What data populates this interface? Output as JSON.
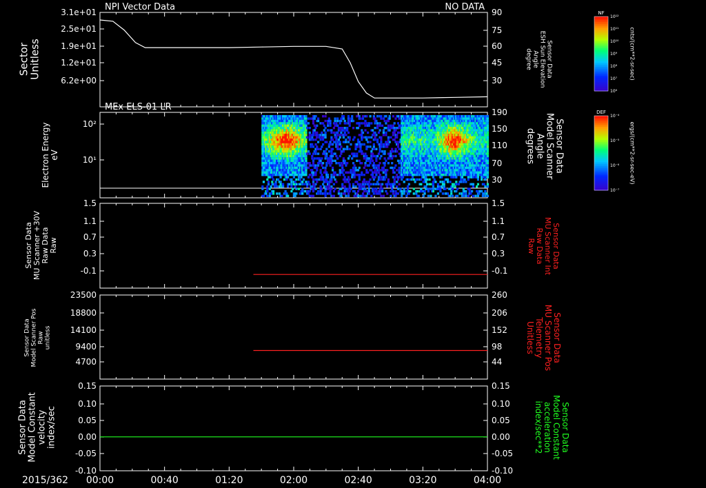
{
  "date_label": "2015/362",
  "time_ticks": [
    "00:00",
    "00:40",
    "01:20",
    "02:00",
    "02:40",
    "03:20",
    "04:00"
  ],
  "panels": [
    {
      "id": "npi",
      "title": "NPI Vector Data",
      "status": "NO DATA",
      "left_label": [
        "Sector",
        "Unitless"
      ],
      "right_label": [
        "Sensor Data",
        "ESH Sun Elevation",
        "Angle",
        "degree"
      ],
      "left_ticks": [
        "3.1e+01",
        "2.5e+01",
        "1.9e+01",
        "1.2e+01",
        "6.2e+00"
      ],
      "right_ticks": [
        "90",
        "75",
        "60",
        "45",
        "30"
      ],
      "colorbar": {
        "top_label": "NF",
        "unit": "cnts/(cm**2-sr-sec)",
        "ticks": [
          "10¹²",
          "10¹¹",
          "10¹⁰",
          "10⁹",
          "10⁸",
          "10⁷",
          "10⁶"
        ]
      }
    },
    {
      "id": "els",
      "title": "MEx ELS-01 LR",
      "left_label": [
        "Electron Energy",
        "eV"
      ],
      "right_label": [
        "Sensor Data",
        "Model Scanner",
        "Angle",
        "degrees"
      ],
      "left_ticks": [
        "10²",
        "10¹"
      ],
      "right_ticks": [
        "190",
        "150",
        "110",
        "70",
        "30"
      ],
      "colorbar": {
        "top_label": "DEF",
        "unit": "ergs/(cm**2-sr-sec-eV)",
        "ticks": [
          "10⁻⁴",
          "10⁻⁵",
          "10⁻⁶",
          "10⁻⁷"
        ]
      }
    },
    {
      "id": "mu30",
      "left_label": [
        "Sensor Data",
        "MU Scanner +30V",
        "Raw Data",
        "Raw"
      ],
      "right_label": [
        "Sensor Data",
        "MU Scanner Int",
        "Raw Data",
        "Raw"
      ],
      "left_ticks": [
        "1.5",
        "1.1",
        "0.7",
        "0.3",
        "-0.1"
      ],
      "right_ticks": [
        "1.5",
        "1.1",
        "0.7",
        "0.3",
        "-0.1"
      ]
    },
    {
      "id": "pos",
      "left_label": [
        "Sensor Data",
        "Model Scanner Pos",
        "Raw",
        "unitless"
      ],
      "right_label": [
        "Sensor Data",
        "MU Scanner Pos",
        "Telemetry",
        "Unitless"
      ],
      "left_ticks": [
        "23500",
        "18800",
        "14100",
        "9400",
        "4700"
      ],
      "right_ticks": [
        "260",
        "206",
        "152",
        "98",
        "44"
      ]
    },
    {
      "id": "const",
      "left_label": [
        "Sensor Data",
        "Model Constant",
        "velocity",
        "index/sec"
      ],
      "right_label": [
        "Sensor Data",
        "Model Constant",
        "acceleration",
        "index/sec**2"
      ],
      "left_ticks": [
        "0.15",
        "0.10",
        "0.05",
        "0.00",
        "-0.05",
        "-0.10"
      ],
      "right_ticks": [
        "0.15",
        "0.10",
        "0.05",
        "0.00",
        "-0.05",
        "-0.10"
      ]
    }
  ],
  "colors": {
    "white": "#ffffff",
    "red": "#ff2020",
    "green": "#20ff20"
  },
  "chart_data": [
    {
      "type": "line",
      "panel": "npi",
      "x_unit": "minutes since 00:00",
      "xlim": [
        0,
        240
      ],
      "ylabel": "Sensor Data ESH Sun Elevation Angle degree",
      "ylim": [
        15,
        90
      ],
      "x": [
        0,
        8,
        15,
        22,
        28,
        40,
        60,
        80,
        100,
        120,
        140,
        150,
        155,
        160,
        165,
        170,
        180,
        200,
        220,
        240
      ],
      "values": [
        84,
        83,
        76,
        66,
        62,
        62,
        62,
        62,
        62.5,
        63,
        63,
        61,
        50,
        35,
        26,
        22,
        22,
        22,
        22.5,
        23
      ]
    },
    {
      "type": "heatmap",
      "panel": "els",
      "title": "MEx ELS-01 LR",
      "ylabel": "Electron Energy eV",
      "data_start_minutes": 100,
      "data_end_minutes": 240,
      "yscale": "log",
      "ylim_log": [
        0.2,
        2.25
      ],
      "colorbar_label": "DEF ergs/(cm**2-sr-sec-eV)"
    },
    {
      "type": "line",
      "panel": "mu30",
      "color": "red",
      "xlim": [
        0,
        240
      ],
      "ylim": [
        -0.3,
        1.5
      ],
      "x": [
        95,
        240
      ],
      "values": [
        -0.01,
        -0.01
      ]
    },
    {
      "type": "line",
      "panel": "pos",
      "color": "red",
      "xlim": [
        0,
        240
      ],
      "ylim": [
        0,
        23500
      ],
      "x": [
        95,
        240
      ],
      "values": [
        8000,
        8000
      ]
    },
    {
      "type": "line",
      "panel": "const",
      "color": "green",
      "xlim": [
        0,
        240
      ],
      "ylim": [
        -0.1,
        0.15
      ],
      "x": [
        0,
        240
      ],
      "values": [
        0,
        0
      ]
    }
  ]
}
